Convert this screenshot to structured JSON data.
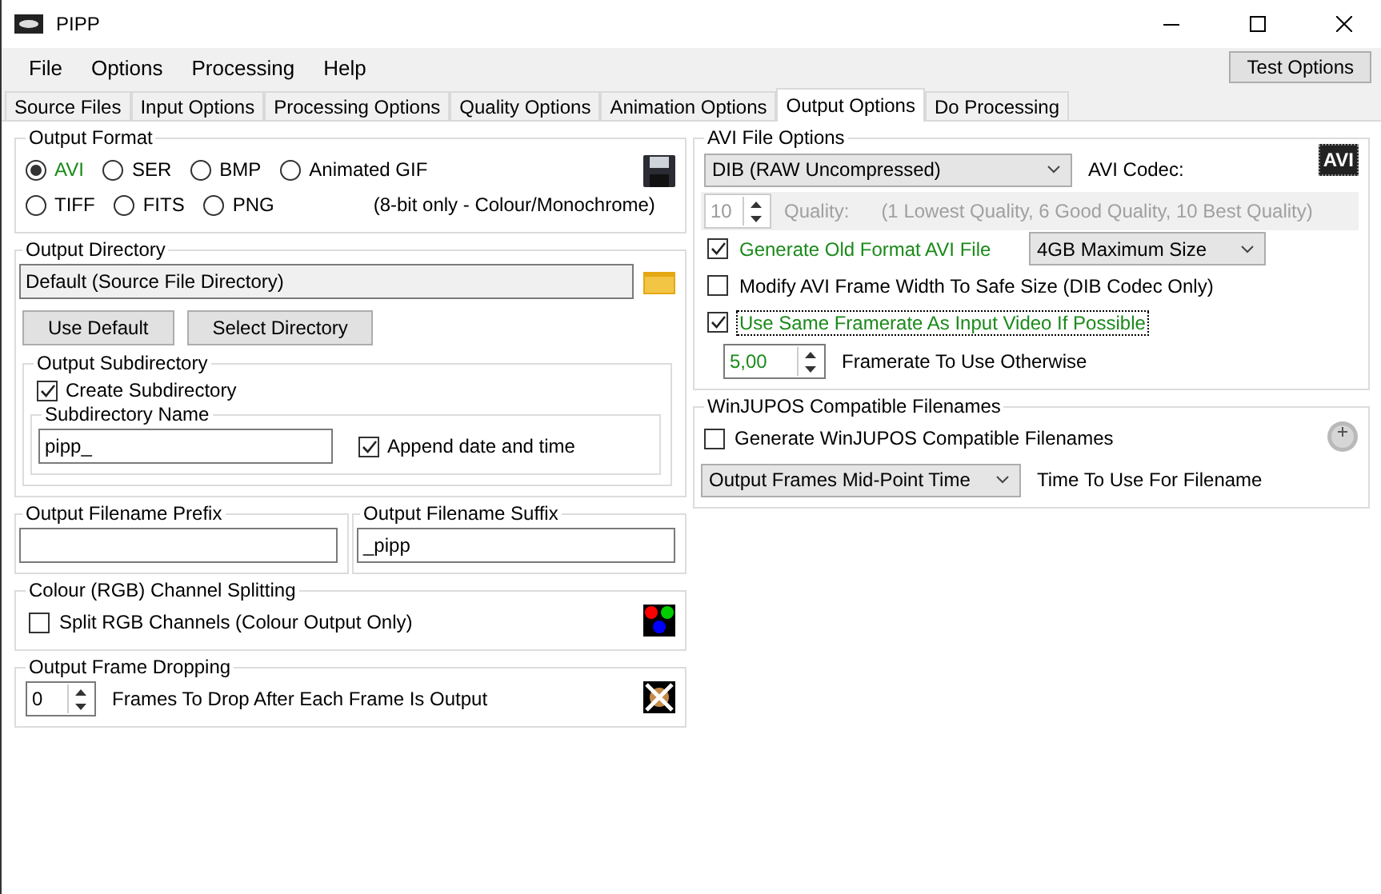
{
  "window": {
    "title": "PIPP"
  },
  "menu": [
    "File",
    "Options",
    "Processing",
    "Help"
  ],
  "menu_button": "Test Options",
  "tabs": [
    {
      "label": "Source Files",
      "selected": false
    },
    {
      "label": "Input Options",
      "selected": false
    },
    {
      "label": "Processing Options",
      "selected": false
    },
    {
      "label": "Quality Options",
      "selected": false
    },
    {
      "label": "Animation Options",
      "selected": false
    },
    {
      "label": "Output Options",
      "selected": true
    },
    {
      "label": "Do Processing",
      "selected": false
    }
  ],
  "output_format": {
    "title": "Output Format",
    "rows": [
      [
        {
          "label": "AVI",
          "selected": true
        },
        {
          "label": "SER",
          "selected": false
        },
        {
          "label": "BMP",
          "selected": false
        },
        {
          "label": "Animated GIF",
          "selected": false
        }
      ],
      [
        {
          "label": "TIFF",
          "selected": false
        },
        {
          "label": "FITS",
          "selected": false
        },
        {
          "label": "PNG",
          "selected": false
        }
      ]
    ],
    "note": "(8-bit only - Colour/Monochrome)"
  },
  "output_directory": {
    "title": "Output Directory",
    "path": "Default (Source File Directory)",
    "buttons": [
      "Use Default",
      "Select Directory"
    ],
    "subdirectory": {
      "title": "Output Subdirectory",
      "create": {
        "label": "Create Subdirectory",
        "checked": true
      },
      "name_title": "Subdirectory Name",
      "name": "pipp_",
      "append": {
        "label": "Append date and time",
        "checked": true
      }
    }
  },
  "filename_prefix": {
    "title": "Output Filename Prefix"
  },
  "filename_suffix": {
    "title": "Output Filename Suffix",
    "value": "_pipp"
  },
  "channel_splitting": {
    "title": "Colour (RGB) Channel Splitting",
    "option": {
      "label": "Split RGB Channels (Colour Output Only)",
      "checked": false
    }
  },
  "frame_dropping": {
    "title": "Output Frame Dropping",
    "value": "0",
    "label": "Frames To Drop After Each Frame Is Output"
  },
  "avi_options": {
    "title": "AVI File Options",
    "badge": "AVI",
    "codec": "DIB (RAW Uncompressed)",
    "codec_label": "AVI Codec:",
    "quality": {
      "value": "10",
      "label": "Quality:",
      "hint": "(1 Lowest Quality, 6 Good Quality, 10 Best Quality)",
      "disabled": true
    },
    "options": [
      {
        "label": "Generate Old Format AVI File",
        "checked": true,
        "focused": false,
        "select": "4GB Maximum Size"
      },
      {
        "label": "Modify AVI Frame Width To Safe Size (DIB Codec Only)",
        "checked": false,
        "focused": false
      },
      {
        "label": "Use Same Framerate As Input Video If Possible",
        "checked": true,
        "focused": true
      }
    ],
    "framerate": {
      "value": "5,00",
      "label": "Framerate To Use Otherwise"
    }
  },
  "winjupos": {
    "title": "WinJUPOS Compatible Filenames",
    "option": {
      "label": "Generate WinJUPOS Compatible Filenames",
      "checked": false
    },
    "time": "Output Frames Mid-Point Time",
    "time_label": "Time To Use For Filename"
  }
}
